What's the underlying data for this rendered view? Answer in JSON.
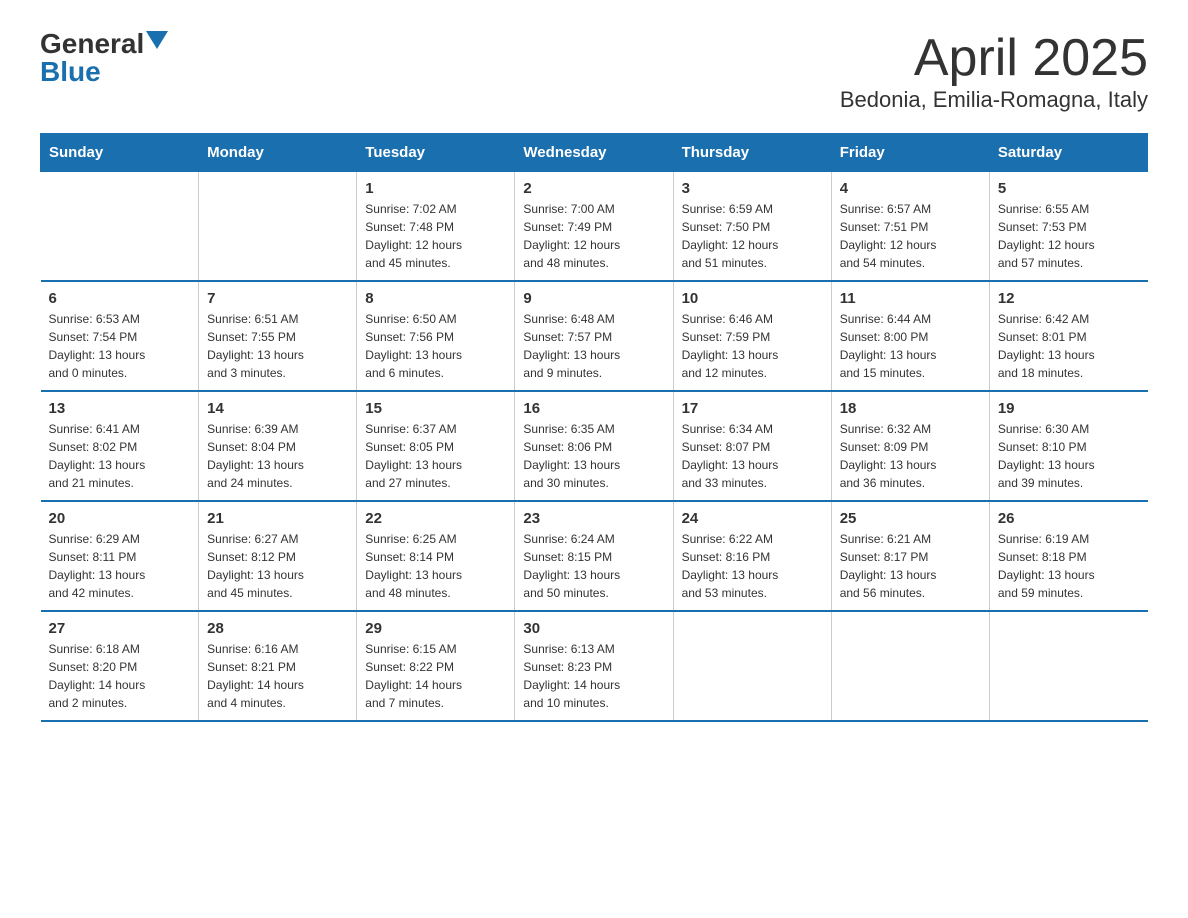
{
  "logo": {
    "text_general": "General",
    "text_blue": "Blue"
  },
  "header": {
    "month": "April 2025",
    "location": "Bedonia, Emilia-Romagna, Italy"
  },
  "weekdays": [
    "Sunday",
    "Monday",
    "Tuesday",
    "Wednesday",
    "Thursday",
    "Friday",
    "Saturday"
  ],
  "weeks": [
    [
      {
        "day": "",
        "info": ""
      },
      {
        "day": "",
        "info": ""
      },
      {
        "day": "1",
        "info": "Sunrise: 7:02 AM\nSunset: 7:48 PM\nDaylight: 12 hours\nand 45 minutes."
      },
      {
        "day": "2",
        "info": "Sunrise: 7:00 AM\nSunset: 7:49 PM\nDaylight: 12 hours\nand 48 minutes."
      },
      {
        "day": "3",
        "info": "Sunrise: 6:59 AM\nSunset: 7:50 PM\nDaylight: 12 hours\nand 51 minutes."
      },
      {
        "day": "4",
        "info": "Sunrise: 6:57 AM\nSunset: 7:51 PM\nDaylight: 12 hours\nand 54 minutes."
      },
      {
        "day": "5",
        "info": "Sunrise: 6:55 AM\nSunset: 7:53 PM\nDaylight: 12 hours\nand 57 minutes."
      }
    ],
    [
      {
        "day": "6",
        "info": "Sunrise: 6:53 AM\nSunset: 7:54 PM\nDaylight: 13 hours\nand 0 minutes."
      },
      {
        "day": "7",
        "info": "Sunrise: 6:51 AM\nSunset: 7:55 PM\nDaylight: 13 hours\nand 3 minutes."
      },
      {
        "day": "8",
        "info": "Sunrise: 6:50 AM\nSunset: 7:56 PM\nDaylight: 13 hours\nand 6 minutes."
      },
      {
        "day": "9",
        "info": "Sunrise: 6:48 AM\nSunset: 7:57 PM\nDaylight: 13 hours\nand 9 minutes."
      },
      {
        "day": "10",
        "info": "Sunrise: 6:46 AM\nSunset: 7:59 PM\nDaylight: 13 hours\nand 12 minutes."
      },
      {
        "day": "11",
        "info": "Sunrise: 6:44 AM\nSunset: 8:00 PM\nDaylight: 13 hours\nand 15 minutes."
      },
      {
        "day": "12",
        "info": "Sunrise: 6:42 AM\nSunset: 8:01 PM\nDaylight: 13 hours\nand 18 minutes."
      }
    ],
    [
      {
        "day": "13",
        "info": "Sunrise: 6:41 AM\nSunset: 8:02 PM\nDaylight: 13 hours\nand 21 minutes."
      },
      {
        "day": "14",
        "info": "Sunrise: 6:39 AM\nSunset: 8:04 PM\nDaylight: 13 hours\nand 24 minutes."
      },
      {
        "day": "15",
        "info": "Sunrise: 6:37 AM\nSunset: 8:05 PM\nDaylight: 13 hours\nand 27 minutes."
      },
      {
        "day": "16",
        "info": "Sunrise: 6:35 AM\nSunset: 8:06 PM\nDaylight: 13 hours\nand 30 minutes."
      },
      {
        "day": "17",
        "info": "Sunrise: 6:34 AM\nSunset: 8:07 PM\nDaylight: 13 hours\nand 33 minutes."
      },
      {
        "day": "18",
        "info": "Sunrise: 6:32 AM\nSunset: 8:09 PM\nDaylight: 13 hours\nand 36 minutes."
      },
      {
        "day": "19",
        "info": "Sunrise: 6:30 AM\nSunset: 8:10 PM\nDaylight: 13 hours\nand 39 minutes."
      }
    ],
    [
      {
        "day": "20",
        "info": "Sunrise: 6:29 AM\nSunset: 8:11 PM\nDaylight: 13 hours\nand 42 minutes."
      },
      {
        "day": "21",
        "info": "Sunrise: 6:27 AM\nSunset: 8:12 PM\nDaylight: 13 hours\nand 45 minutes."
      },
      {
        "day": "22",
        "info": "Sunrise: 6:25 AM\nSunset: 8:14 PM\nDaylight: 13 hours\nand 48 minutes."
      },
      {
        "day": "23",
        "info": "Sunrise: 6:24 AM\nSunset: 8:15 PM\nDaylight: 13 hours\nand 50 minutes."
      },
      {
        "day": "24",
        "info": "Sunrise: 6:22 AM\nSunset: 8:16 PM\nDaylight: 13 hours\nand 53 minutes."
      },
      {
        "day": "25",
        "info": "Sunrise: 6:21 AM\nSunset: 8:17 PM\nDaylight: 13 hours\nand 56 minutes."
      },
      {
        "day": "26",
        "info": "Sunrise: 6:19 AM\nSunset: 8:18 PM\nDaylight: 13 hours\nand 59 minutes."
      }
    ],
    [
      {
        "day": "27",
        "info": "Sunrise: 6:18 AM\nSunset: 8:20 PM\nDaylight: 14 hours\nand 2 minutes."
      },
      {
        "day": "28",
        "info": "Sunrise: 6:16 AM\nSunset: 8:21 PM\nDaylight: 14 hours\nand 4 minutes."
      },
      {
        "day": "29",
        "info": "Sunrise: 6:15 AM\nSunset: 8:22 PM\nDaylight: 14 hours\nand 7 minutes."
      },
      {
        "day": "30",
        "info": "Sunrise: 6:13 AM\nSunset: 8:23 PM\nDaylight: 14 hours\nand 10 minutes."
      },
      {
        "day": "",
        "info": ""
      },
      {
        "day": "",
        "info": ""
      },
      {
        "day": "",
        "info": ""
      }
    ]
  ]
}
